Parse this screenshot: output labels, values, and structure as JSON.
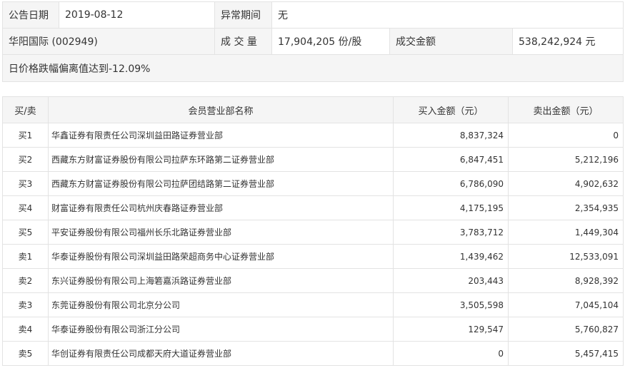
{
  "info": {
    "date_label": "公告日期",
    "date_value": "2019-08-12",
    "period_label": "异常期间",
    "period_value": "无",
    "stock_name": "华阳国际 (002949)",
    "volume_label": "成 交 量",
    "volume_value": "17,904,205 份/股",
    "amount_label": "成交金额",
    "amount_value": "538,242,924 元",
    "reason": "日价格跌幅偏离值达到-12.09%"
  },
  "trades": {
    "headers": {
      "side": "买/卖",
      "name": "会员营业部名称",
      "buy": "买入金额（元）",
      "sell": "卖出金额（元）"
    },
    "rows": [
      {
        "side": "买1",
        "name": "华鑫证券有限责任公司深圳益田路证券营业部",
        "buy": "8,837,324",
        "sell": "0"
      },
      {
        "side": "买2",
        "name": "西藏东方财富证券股份有限公司拉萨东环路第二证券营业部",
        "buy": "6,847,451",
        "sell": "5,212,196"
      },
      {
        "side": "买3",
        "name": "西藏东方财富证券股份有限公司拉萨团结路第二证券营业部",
        "buy": "6,786,090",
        "sell": "4,902,632"
      },
      {
        "side": "买4",
        "name": "财富证券有限责任公司杭州庆春路证券营业部",
        "buy": "4,175,195",
        "sell": "2,354,935"
      },
      {
        "side": "买5",
        "name": "平安证券股份有限公司福州长乐北路证券营业部",
        "buy": "3,783,712",
        "sell": "1,449,304"
      },
      {
        "side": "卖1",
        "name": "华泰证券股份有限公司深圳益田路荣超商务中心证券营业部",
        "buy": "1,439,462",
        "sell": "12,533,091"
      },
      {
        "side": "卖2",
        "name": "东兴证券股份有限公司上海箬嘉浜路证券营业部",
        "buy": "203,443",
        "sell": "8,928,392"
      },
      {
        "side": "卖3",
        "name": "东莞证券股份有限公司北京分公司",
        "buy": "3,505,598",
        "sell": "7,045,104"
      },
      {
        "side": "卖4",
        "name": "华泰证券股份有限公司浙江分公司",
        "buy": "129,547",
        "sell": "5,760,827"
      },
      {
        "side": "卖5",
        "name": "华创证券有限责任公司成都天府大道证券营业部",
        "buy": "0",
        "sell": "5,457,415"
      }
    ]
  }
}
